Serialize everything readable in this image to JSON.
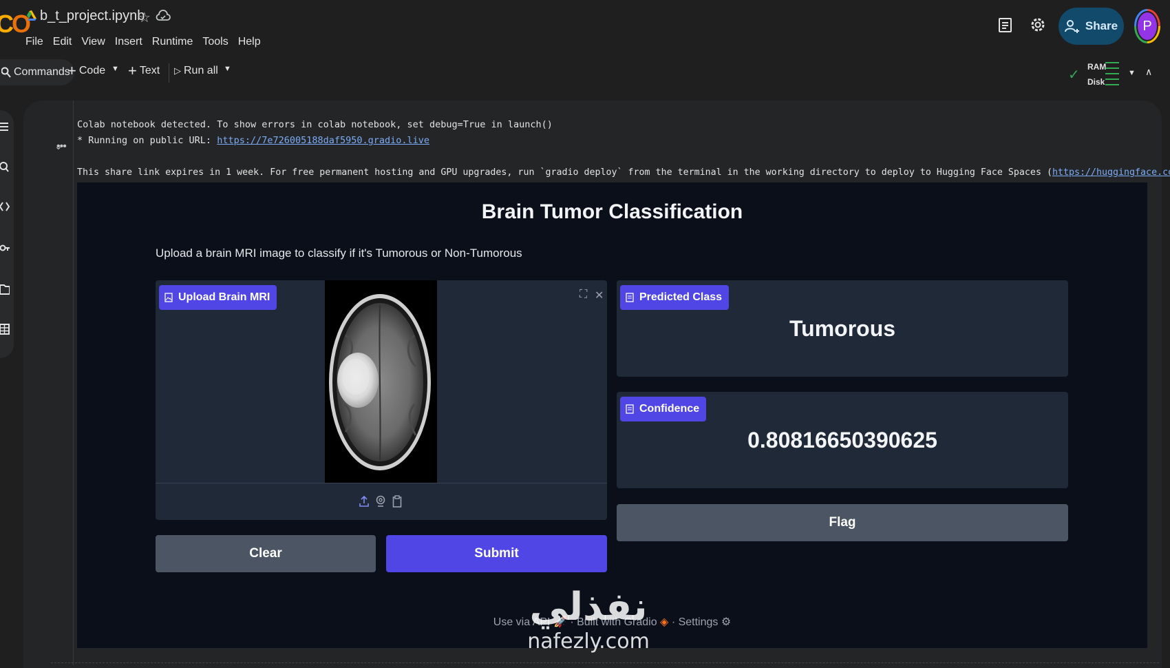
{
  "app": {
    "notebook_title": "b_t_project.ipynb",
    "menu": [
      "File",
      "Edit",
      "View",
      "Insert",
      "Runtime",
      "Tools",
      "Help"
    ],
    "share_label": "Share",
    "avatar_letter": "P"
  },
  "toolbar": {
    "commands_label": "Commands",
    "code_label": "Code",
    "text_label": "Text",
    "run_all_label": "Run all",
    "ram_label": "RAM",
    "disk_label": "Disk"
  },
  "output": {
    "line1": "Colab notebook detected. To show errors in colab notebook, set debug=True in launch()",
    "line2_prefix": "* Running on public URL: ",
    "line2_url": "https://7e726005188daf5950.gradio.live",
    "line3_prefix": "This share link expires in 1 week. For free permanent hosting and GPU upgrades, run `gradio deploy` from the terminal in the working directory to deploy to Hugging Face Spaces (",
    "line3_url": "https://huggingface.co/spaces",
    "line3_suffix": ")"
  },
  "gradio": {
    "title": "Brain Tumor Classification",
    "description": "Upload a brain MRI image to classify if it's Tumorous or Non-Tumorous",
    "upload_label": "Upload Brain MRI",
    "predicted_label": "Predicted Class",
    "predicted_value": "Tumorous",
    "confidence_label": "Confidence",
    "confidence_value": "0.80816650390625",
    "flag_label": "Flag",
    "clear_label": "Clear",
    "submit_label": "Submit",
    "footer_api": "Use via API",
    "footer_built": "Built with Gradio",
    "footer_settings": "Settings"
  },
  "watermark": {
    "arabic": "نفذلي",
    "english": "nafezly.com"
  },
  "colors": {
    "accent": "#4f46e5",
    "panel": "#1f2937",
    "app_bg": "#0b0f19"
  }
}
